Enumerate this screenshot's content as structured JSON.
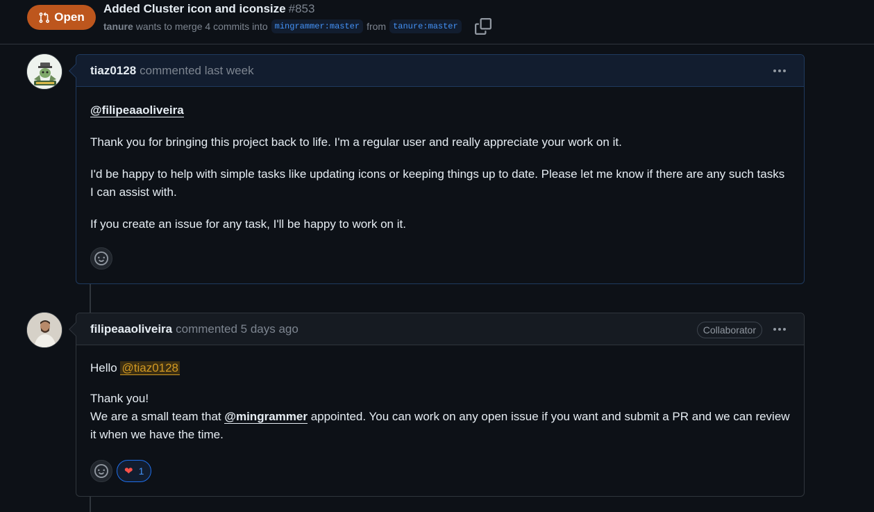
{
  "pr": {
    "state_label": "Open",
    "title": "Added Cluster icon and iconsize",
    "number": "#853",
    "author": "tanure",
    "merge_text": "wants to merge 4 commits into",
    "base_branch": "mingrammer:master",
    "from_text": "from",
    "head_branch": "tanure:master"
  },
  "comments": [
    {
      "author": "tiaz0128",
      "meta": "commented last week",
      "mention": "@filipeaaoliveira",
      "paragraphs": [
        "Thank you for bringing this project back to life. I'm a regular user and really appreciate your work on it.",
        "I'd be happy to help with simple tasks like updating icons or keeping things up to date. Please let me know if there are any such tasks I can assist with.",
        "If you create an issue for any task, I'll be happy to work on it."
      ]
    },
    {
      "author": "filipeaaoliveira",
      "meta": "commented 5 days ago",
      "role": "Collaborator",
      "greeting": "Hello",
      "mention": "@tiaz0128",
      "line1": "Thank you!",
      "line2_pre": "We are a small team that",
      "line2_mention": "@mingrammer",
      "line2_post": "appointed. You can work on any open issue if you want and submit a PR and we can review it when we have the time.",
      "reaction_count": "1"
    }
  ],
  "icons": {
    "state": "git-pull-request-icon",
    "copy": "copy-icon",
    "smiley": "smiley-icon",
    "kebab": "kebab-horizontal-icon",
    "heart": "heart-icon"
  },
  "colors": {
    "open_badge": "#bd561d",
    "branch_text": "#4493f8",
    "mention_highlight": "#d29922",
    "heart": "#f85149"
  }
}
